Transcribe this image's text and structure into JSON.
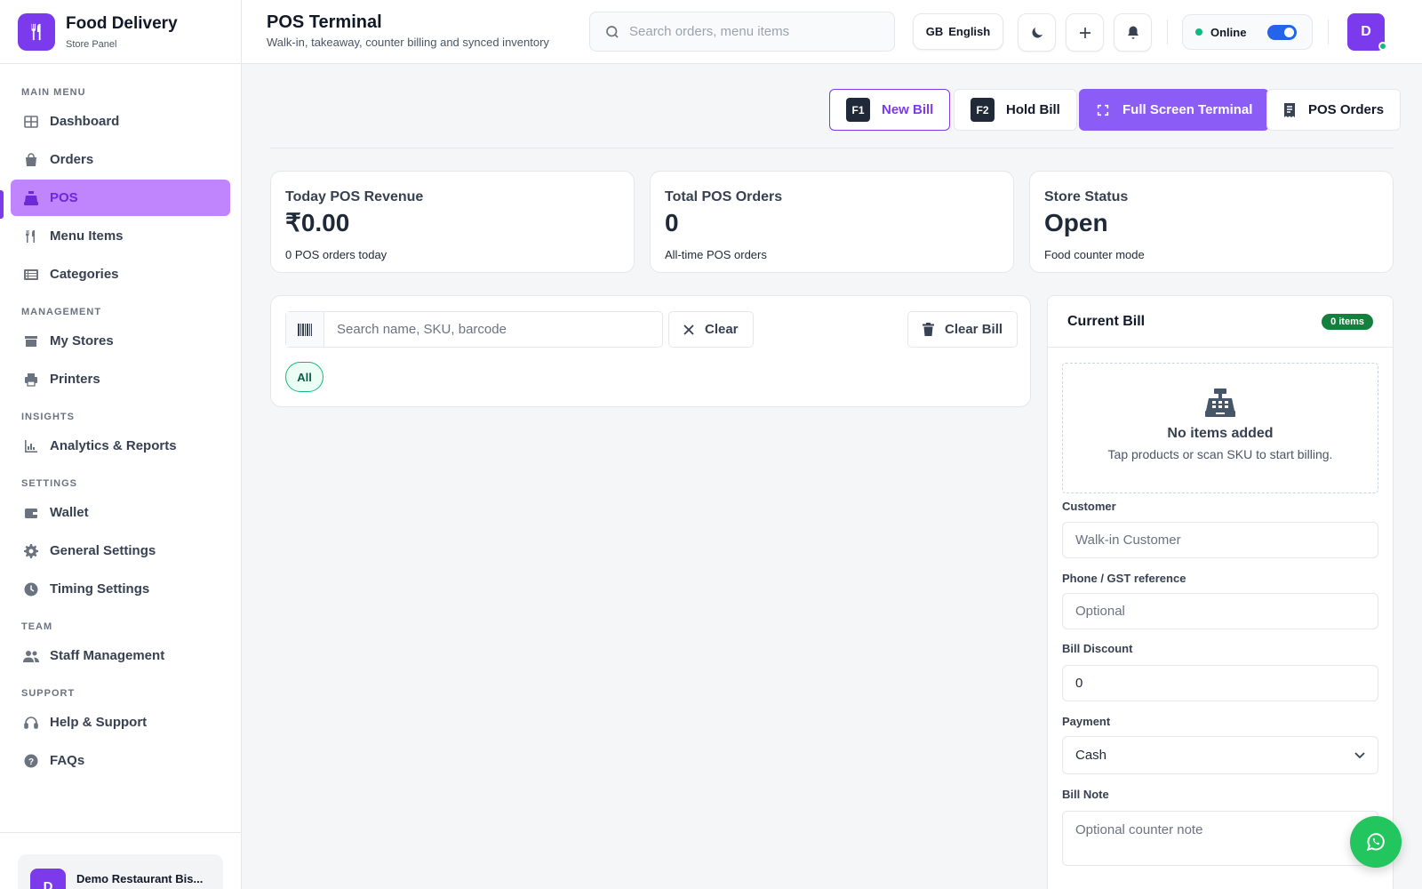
{
  "brand": {
    "title": "Food Delivery",
    "subtitle": "Store Panel"
  },
  "sidebar": {
    "sections": [
      {
        "title": "MAIN MENU",
        "items": [
          {
            "label": "Dashboard",
            "icon": "grid-icon"
          },
          {
            "label": "Orders",
            "icon": "bag-icon"
          },
          {
            "label": "POS",
            "icon": "register-icon",
            "active": true
          },
          {
            "label": "Menu Items",
            "icon": "utensils-icon"
          },
          {
            "label": "Categories",
            "icon": "list-icon"
          }
        ]
      },
      {
        "title": "MANAGEMENT",
        "items": [
          {
            "label": "My Stores",
            "icon": "store-icon"
          },
          {
            "label": "Printers",
            "icon": "printer-icon"
          }
        ]
      },
      {
        "title": "INSIGHTS",
        "items": [
          {
            "label": "Analytics & Reports",
            "icon": "chart-icon"
          }
        ]
      },
      {
        "title": "SETTINGS",
        "items": [
          {
            "label": "Wallet",
            "icon": "wallet-icon"
          },
          {
            "label": "General Settings",
            "icon": "gear-icon"
          },
          {
            "label": "Timing Settings",
            "icon": "clock-icon"
          }
        ]
      },
      {
        "title": "TEAM",
        "items": [
          {
            "label": "Staff Management",
            "icon": "users-icon"
          }
        ]
      },
      {
        "title": "SUPPORT",
        "items": [
          {
            "label": "Help & Support",
            "icon": "headset-icon"
          },
          {
            "label": "FAQs",
            "icon": "question-icon"
          }
        ]
      }
    ],
    "store": {
      "avatar": "D",
      "name": "Demo Restaurant Bis..."
    }
  },
  "header": {
    "title": "POS Terminal",
    "subtitle": "Walk-in, takeaway, counter billing and synced inventory",
    "search_placeholder": "Search orders, menu items",
    "language_code": "GB",
    "language": "English",
    "status": "Online",
    "user_avatar": "D"
  },
  "toolbar": {
    "new_bill_key": "F1",
    "new_bill": "New Bill",
    "hold_bill_key": "F2",
    "hold_bill": "Hold Bill",
    "full_screen": "Full Screen Terminal",
    "pos_orders": "POS Orders"
  },
  "stats": [
    {
      "label": "Today POS Revenue",
      "value": "₹0.00",
      "sub": "0 POS orders today"
    },
    {
      "label": "Total POS Orders",
      "value": "0",
      "sub": "All-time POS orders"
    },
    {
      "label": "Store Status",
      "value": "Open",
      "sub": "Food counter mode"
    }
  ],
  "products": {
    "search_placeholder": "Search name, SKU, barcode",
    "clear": "Clear",
    "clear_bill": "Clear Bill",
    "category_all": "All"
  },
  "bill": {
    "title": "Current Bill",
    "items_badge": "0 items",
    "empty_title": "No items added",
    "empty_sub": "Tap products or scan SKU to start billing.",
    "customer_label": "Customer",
    "customer_placeholder": "Walk-in Customer",
    "phone_label": "Phone / GST reference",
    "phone_placeholder": "Optional",
    "discount_label": "Bill Discount",
    "discount_value": "0",
    "payment_label": "Payment",
    "payment_value": "Cash",
    "note_label": "Bill Note",
    "note_placeholder": "Optional counter note"
  },
  "colors": {
    "accent": "#7c3aed",
    "success": "#10b981",
    "whatsapp": "#22c55e"
  }
}
